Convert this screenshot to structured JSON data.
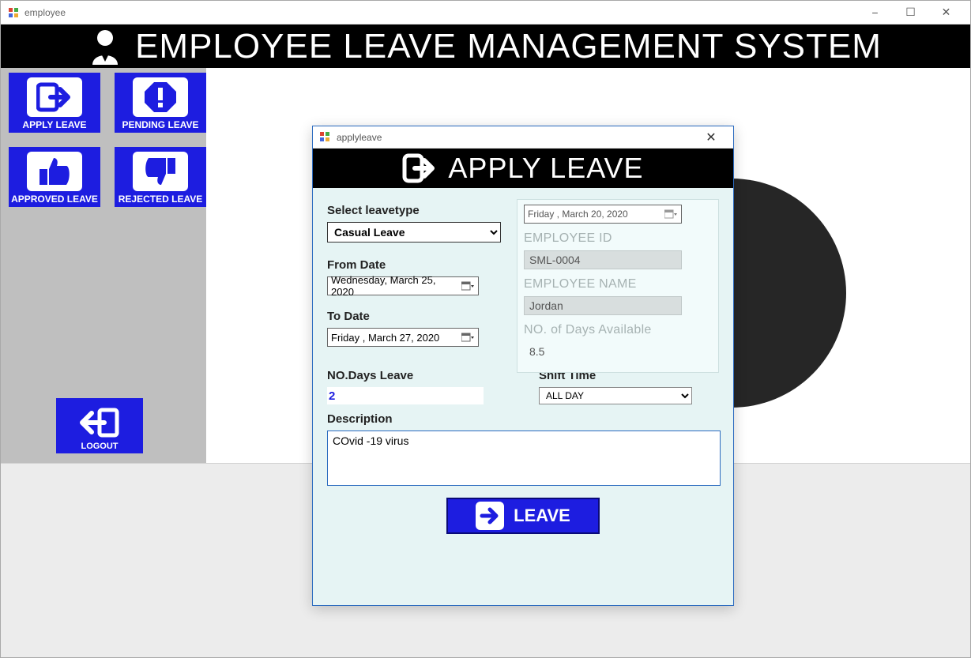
{
  "window": {
    "title": "employee",
    "minimize": "−",
    "maximize": "☐",
    "close": "✕"
  },
  "header": {
    "title": "EMPLOYEE LEAVE MANAGEMENT SYSTEM"
  },
  "sidebar": {
    "apply": "APPLY LEAVE",
    "pending": "PENDING LEAVE",
    "approved": "APPROVED LEAVE",
    "rejected": "REJECTED LEAVE",
    "logout": "LOGOUT"
  },
  "modal": {
    "title": "applyleave",
    "close": "✕",
    "banner": "APPLY LEAVE",
    "labels": {
      "leavetype": "Select leavetype",
      "from": "From Date",
      "to": "To Date",
      "ndays": "NO.Days Leave",
      "shift": "Shift Time",
      "desc": "Description",
      "empid": "EMPLOYEE ID",
      "empname": "EMPLOYEE NAME",
      "avail": "NO. of Days Available"
    },
    "values": {
      "leavetype": "Casual Leave",
      "from": "Wednesday,    March     25, 2020",
      "to": "  Friday     ,    March     27, 2020",
      "today": "  Friday     ,    March    20, 2020",
      "empid": "SML-0004",
      "empname": "Jordan",
      "avail": "8.5",
      "ndays": "2",
      "shift": "ALL DAY",
      "desc": "COvid -19 virus"
    },
    "submit": "LEAVE"
  }
}
